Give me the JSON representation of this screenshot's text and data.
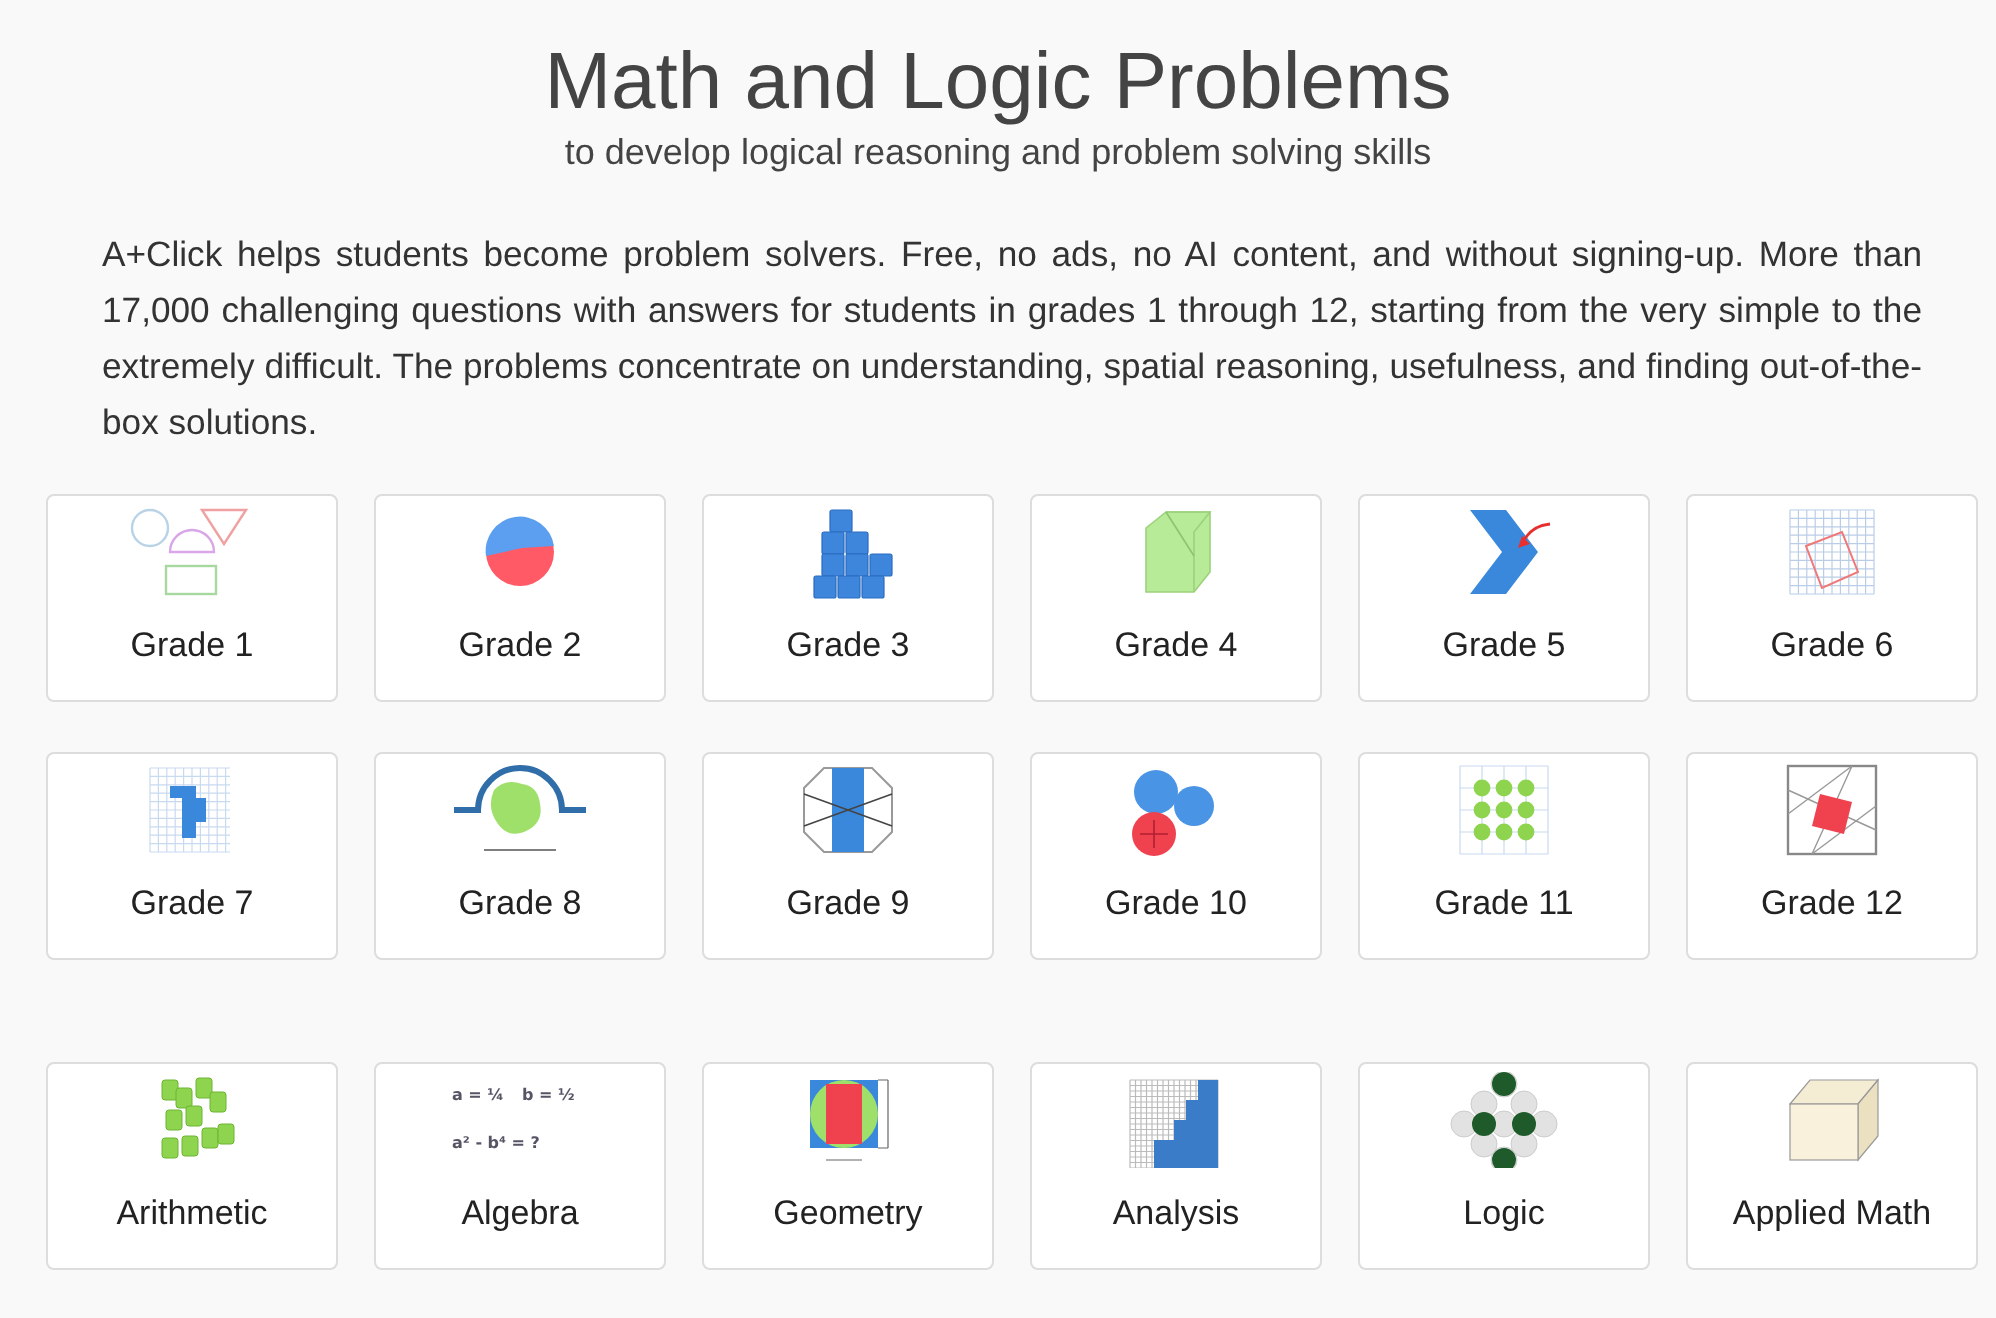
{
  "title": "Math and Logic Problems",
  "subtitle": "to develop logical reasoning and problem solving skills",
  "intro": "A+Click helps students become problem solvers. Free, no ads, no AI content, and without signing-up. More than 17,000 challenging questions with answers for students in grades 1 through 12, starting from the very simple to the extremely difficult. The problems concentrate on understanding, spatial reasoning, usefulness, and finding out-of-the-box solutions.",
  "sections": [
    {
      "cards": [
        {
          "label": "Grade 1",
          "kind": "shapes"
        },
        {
          "label": "Grade 2",
          "kind": "pie"
        },
        {
          "label": "Grade 3",
          "kind": "cubes"
        },
        {
          "label": "Grade 4",
          "kind": "cube"
        },
        {
          "label": "Grade 5",
          "kind": "chevron"
        },
        {
          "label": "Grade 6",
          "kind": "grid-square"
        },
        {
          "label": "Grade 7",
          "kind": "grid-bars"
        },
        {
          "label": "Grade 8",
          "kind": "arch"
        },
        {
          "label": "Grade 9",
          "kind": "octagon"
        },
        {
          "label": "Grade 10",
          "kind": "circles"
        },
        {
          "label": "Grade 11",
          "kind": "dots"
        },
        {
          "label": "Grade 12",
          "kind": "tilted-square"
        }
      ]
    },
    {
      "cards": [
        {
          "label": "Arithmetic",
          "kind": "number-tiles"
        },
        {
          "label": "Algebra",
          "kind": "formula",
          "icon_text": [
            "a = ¼",
            "b = ½",
            "a² - b⁴ = ?"
          ]
        },
        {
          "label": "Geometry",
          "kind": "inscribed"
        },
        {
          "label": "Analysis",
          "kind": "staircase"
        },
        {
          "label": "Logic",
          "kind": "hexagons"
        },
        {
          "label": "Applied Math",
          "kind": "box"
        }
      ]
    }
  ]
}
